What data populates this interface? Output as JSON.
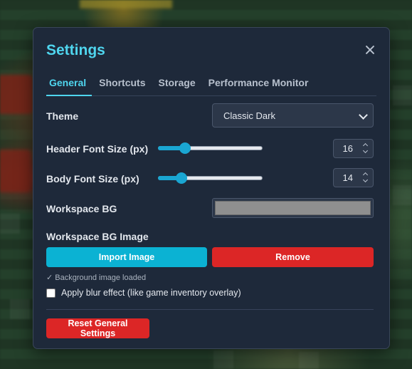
{
  "colors": {
    "accent": "#4fd5ee",
    "dialog_bg": "#1e293a",
    "import_button": "#0bb2d3",
    "danger_button": "#dc2626",
    "workspace_bg_swatch": "#8f8f8f"
  },
  "dialog": {
    "title": "Settings",
    "close_icon": "close-icon"
  },
  "tabs": [
    {
      "label": "General",
      "active": true
    },
    {
      "label": "Shortcuts",
      "active": false
    },
    {
      "label": "Storage",
      "active": false
    },
    {
      "label": "Performance Monitor",
      "active": false
    }
  ],
  "general": {
    "theme": {
      "label": "Theme",
      "selected": "Classic Dark"
    },
    "header_font_size": {
      "label": "Header Font Size (px)",
      "value": "16",
      "slider_fraction": 0.23
    },
    "body_font_size": {
      "label": "Body Font Size (px)",
      "value": "14",
      "slider_fraction": 0.19
    },
    "workspace_bg": {
      "label": "Workspace BG",
      "color": "#8f8f8f"
    },
    "workspace_bg_image": {
      "label": "Workspace BG Image",
      "import_label": "Import Image",
      "remove_label": "Remove",
      "status": "✓ Background image loaded"
    },
    "blur": {
      "label": "Apply blur effect (like game inventory overlay)",
      "checked": false
    },
    "reset_label": "Reset General Settings"
  }
}
